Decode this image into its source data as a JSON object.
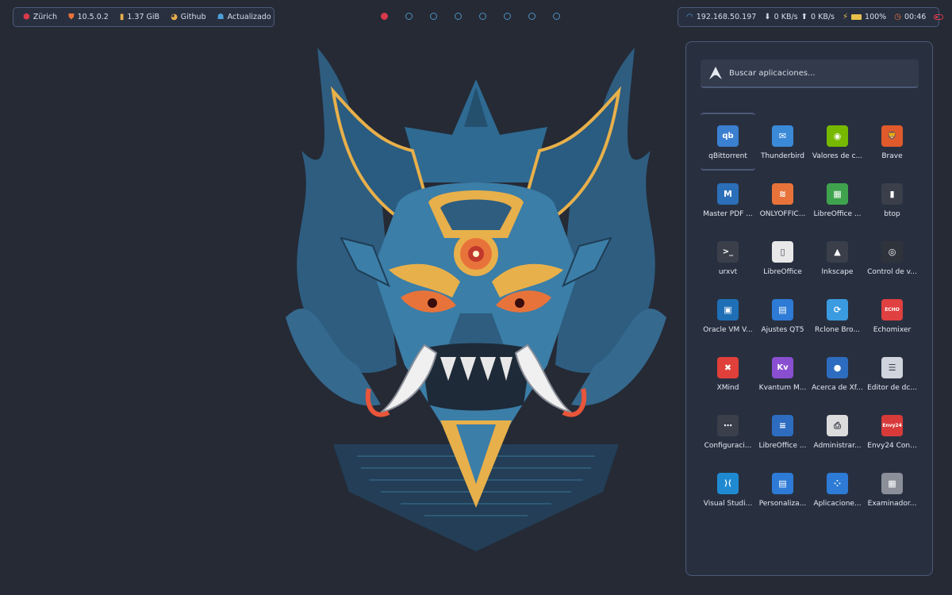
{
  "topbar_left": {
    "location": "Zürich",
    "version": "10.5.0.2",
    "memory": "1.37 GiB",
    "github": "Github",
    "updates": "Actualizado"
  },
  "workspaces": {
    "count": 8,
    "active_index": 0
  },
  "topbar_right": {
    "ip": "192.168.50.197",
    "download": "0 KB/s",
    "upload": "0 KB/s",
    "battery": "100%",
    "time": "00:46"
  },
  "launcher": {
    "search_placeholder": "Buscar aplicaciones...",
    "apps": [
      {
        "label": "qBittorrent",
        "icon": "qbittorrent-icon",
        "color": "#3b7fd1",
        "glyph": "qb"
      },
      {
        "label": "Thunderbird",
        "icon": "thunderbird-icon",
        "color": "#3a8ad8",
        "glyph": "✉"
      },
      {
        "label": "Valores de c...",
        "icon": "nvidia-icon",
        "color": "#76b900",
        "glyph": "◉"
      },
      {
        "label": "Brave",
        "icon": "brave-icon",
        "color": "#e05a2b",
        "glyph": "🦁"
      },
      {
        "label": "Master PDF ...",
        "icon": "masterpdf-icon",
        "color": "#2a6fb8",
        "glyph": "M"
      },
      {
        "label": "ONLYOFFIC...",
        "icon": "onlyoffice-icon",
        "color": "#e8733a",
        "glyph": "≋"
      },
      {
        "label": "LibreOffice ...",
        "icon": "libreoffice-calc-icon",
        "color": "#3fa34d",
        "glyph": "▦"
      },
      {
        "label": "btop",
        "icon": "btop-icon",
        "color": "#3a3f4a",
        "glyph": "▮"
      },
      {
        "label": "urxvt",
        "icon": "terminal-icon",
        "color": "#3a3f4a",
        "glyph": ">_"
      },
      {
        "label": "LibreOffice",
        "icon": "libreoffice-icon",
        "color": "#e8e8e8",
        "glyph": "▯"
      },
      {
        "label": "Inkscape",
        "icon": "inkscape-icon",
        "color": "#3a3f4a",
        "glyph": "▲"
      },
      {
        "label": "Control de v...",
        "icon": "volume-control-icon",
        "color": "#2f333c",
        "glyph": "◎"
      },
      {
        "label": "Oracle VM V...",
        "icon": "virtualbox-icon",
        "color": "#1e6fb6",
        "glyph": "▣"
      },
      {
        "label": "Ajustes QT5",
        "icon": "qt5-settings-icon",
        "color": "#2d7bd6",
        "glyph": "▤"
      },
      {
        "label": "Rclone Bro...",
        "icon": "rclone-icon",
        "color": "#3a9be0",
        "glyph": "⟳"
      },
      {
        "label": "Echomixer",
        "icon": "echomixer-icon",
        "color": "#e04040",
        "glyph": "ECHO"
      },
      {
        "label": "XMind",
        "icon": "xmind-icon",
        "color": "#e0403a",
        "glyph": "✖"
      },
      {
        "label": "Kvantum M...",
        "icon": "kvantum-icon",
        "color": "#8a4fd0",
        "glyph": "Kv"
      },
      {
        "label": "Acerca de Xf...",
        "icon": "xfce-about-icon",
        "color": "#2e6cc0",
        "glyph": "●"
      },
      {
        "label": "Editor de dc...",
        "icon": "dconf-editor-icon",
        "color": "#d0d4dc",
        "glyph": "☰"
      },
      {
        "label": "Configuraci...",
        "icon": "settings-icon",
        "color": "#3a3f4a",
        "glyph": "⋯"
      },
      {
        "label": "LibreOffice ...",
        "icon": "libreoffice-writer-icon",
        "color": "#2e6cc0",
        "glyph": "≡"
      },
      {
        "label": "Administrar...",
        "icon": "printer-icon",
        "color": "#dcdcdc",
        "glyph": "⎙"
      },
      {
        "label": "Envy24 Con...",
        "icon": "envy24-icon",
        "color": "#d83a3a",
        "glyph": "Envy24"
      },
      {
        "label": "Visual Studi...",
        "icon": "vscode-icon",
        "color": "#1f8ad2",
        "glyph": "⟩⟨"
      },
      {
        "label": "Personaliza...",
        "icon": "personalize-icon",
        "color": "#2d7bd6",
        "glyph": "▤"
      },
      {
        "label": "Aplicacione...",
        "icon": "applications-icon",
        "color": "#2d7bd6",
        "glyph": "⁘"
      },
      {
        "label": "Examinador...",
        "icon": "network-icon",
        "color": "#8a8f99",
        "glyph": "▦"
      }
    ]
  }
}
